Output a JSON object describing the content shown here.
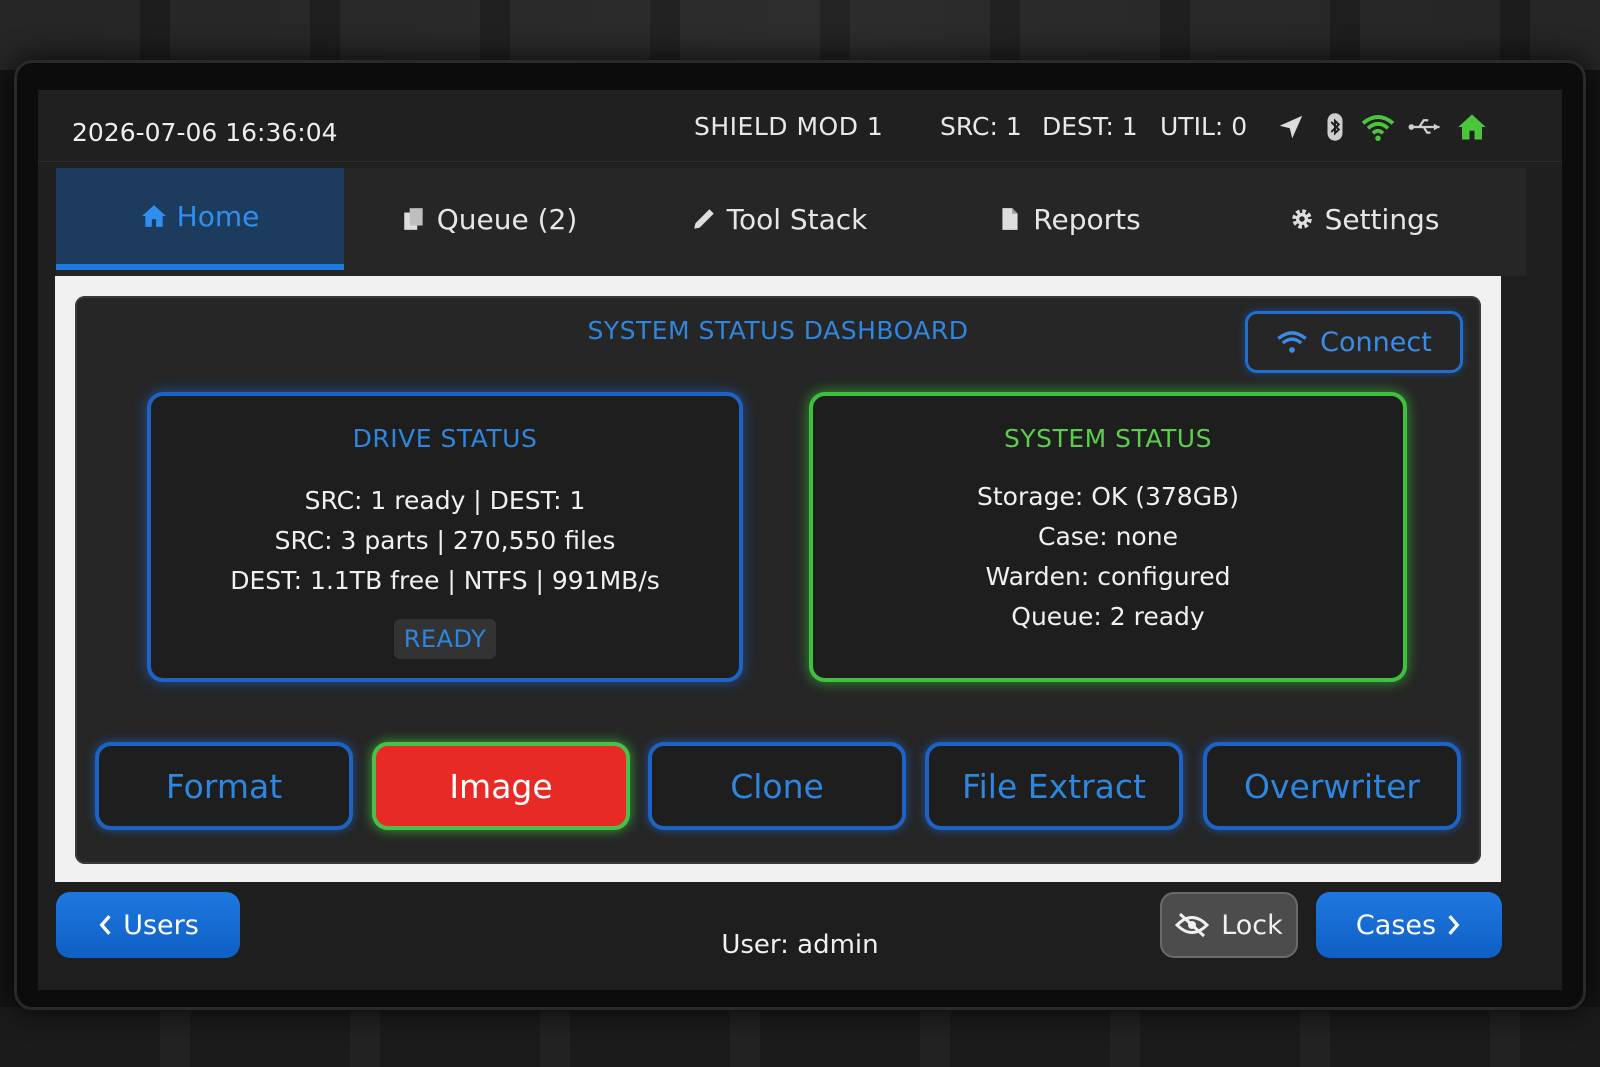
{
  "status_bar": {
    "datetime": "2026-07-06 16:36:04",
    "device_name": "SHIELD MOD 1",
    "src": "SRC: 1",
    "dest": "DEST: 1",
    "util": "UTIL: 0",
    "icons": [
      "location-arrow-icon",
      "bluetooth-icon",
      "wifi-icon",
      "usb-icon",
      "home-icon"
    ]
  },
  "tabs": [
    {
      "label": "Home",
      "icon": "home-icon",
      "active": true
    },
    {
      "label": "Queue (2)",
      "icon": "copy-icon",
      "active": false
    },
    {
      "label": "Tool Stack",
      "icon": "pencil-icon",
      "active": false
    },
    {
      "label": "Reports",
      "icon": "file-icon",
      "active": false
    },
    {
      "label": "Settings",
      "icon": "gear-icon",
      "active": false
    }
  ],
  "dashboard": {
    "title": "SYSTEM STATUS DASHBOARD",
    "connect_label": "Connect"
  },
  "drive_status": {
    "title": "DRIVE STATUS",
    "lines": [
      "SRC: 1 ready | DEST: 1",
      "SRC: 3 parts | 270,550 files",
      "DEST: 1.1TB free | NTFS | 991MB/s"
    ],
    "badge": "READY"
  },
  "system_status": {
    "title": "SYSTEM STATUS",
    "lines": [
      "Storage: OK (378GB)",
      "Case: none",
      "Warden: configured",
      "Queue: 2 ready"
    ]
  },
  "actions": [
    {
      "label": "Format",
      "active": false
    },
    {
      "label": "Image",
      "active": true
    },
    {
      "label": "Clone",
      "active": false
    },
    {
      "label": "File Extract",
      "active": false
    },
    {
      "label": "Overwriter",
      "active": false
    }
  ],
  "bottom": {
    "users_label": "Users",
    "user_text": "User: admin",
    "lock_label": "Lock",
    "cases_label": "Cases"
  },
  "colors": {
    "accent_blue": "#2e86de",
    "accent_green": "#5ad04a",
    "active_red": "#e82a27",
    "button_blue": "#1e78e0"
  }
}
